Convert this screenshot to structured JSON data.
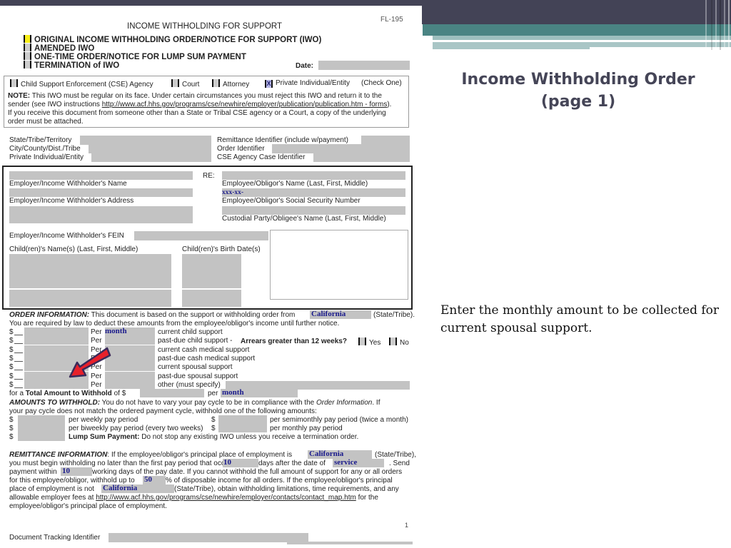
{
  "slide": {
    "title_line1": "Income Withholding Order",
    "title_line2": "(page 1)",
    "note": "Enter the monthly amount to be collected for current spousal support.",
    "colors": {
      "header_dark": "#434356",
      "header_teal": "#4a8483",
      "title": "#454557",
      "arrow": "#e8202a"
    }
  },
  "form": {
    "form_number": "FL-195",
    "heading": "INCOME WITHHOLDING FOR SUPPORT",
    "type_options": [
      {
        "label": "ORIGINAL INCOME WITHHOLDING ORDER/NOTICE FOR SUPPORT (IWO)",
        "state": "highlighted"
      },
      {
        "label": "AMENDED IWO",
        "state": "unchecked"
      },
      {
        "label": "ONE-TIME ORDER/NOTICE FOR LUMP SUM PAYMENT",
        "state": "unchecked"
      },
      {
        "label": "TERMINATION of IWO",
        "state": "unchecked"
      }
    ],
    "date_label": "Date:",
    "sender_options": [
      {
        "label": "Child Support Enforcement (CSE) Agency",
        "mark": ""
      },
      {
        "label": "Court",
        "mark": ""
      },
      {
        "label": "Attorney",
        "mark": ""
      },
      {
        "label": "Private Individual/Entity",
        "mark": "X"
      }
    ],
    "check_one": "(Check One)",
    "note_label": "NOTE:",
    "note_text1": " This IWO must be regular on its face. Under certain circumstances you must reject this IWO and return it to the",
    "note_text2a": "sender (see IWO instructions ",
    "note_link": "http://www.acf.hhs.gov/programs/cse/newhire/employer/publication/publication.htm - forms",
    "note_text2b": ").",
    "note_text3": "If you receive this document from someone other than a State or Tribal CSE agency or a Court, a copy of the underlying",
    "note_text4": "order must be attached.",
    "id_left": [
      "State/Tribe/Territory",
      "City/County/Dist./Tribe",
      "Private Individual/Entity"
    ],
    "id_right": [
      "Remittance Identifier (include w/payment)",
      "Order Identifier",
      "CSE Agency Case Identifier"
    ],
    "re_label": "RE:",
    "employer_name_label": "Employer/Income Withholder's Name",
    "employer_address_label": "Employer/Income Withholder's Address",
    "employee_name_label": "Employee/Obligor's Name (Last, First, Middle)",
    "ssn_value": "xxx-xx-",
    "ssn_label": "Employee/Obligor's Social Security Number",
    "custodial_label": "Custodial Party/Obligee's Name (Last, First, Middle)",
    "fein_label": "Employer/Income Withholder's FEIN",
    "children_names_label": "Child(ren)'s Name(s) (Last, First, Middle)",
    "children_dob_label": "Child(ren)'s Birth Date(s)",
    "order_info": {
      "heading": "ORDER INFORMATION:",
      "text1": " This document is based on the support or withholding order from ",
      "state_value": "California",
      "state_suffix": "(State/Tribe).",
      "text2": "You are required by law to deduct these amounts from the employee/obligor's income until further notice.",
      "dollar": "$",
      "per": "Per",
      "rows": [
        {
          "per_value": "month",
          "description": "current child support"
        },
        {
          "per_value": "",
          "description": "past-due child support - "
        },
        {
          "per_value": "",
          "description": "current cash medical support"
        },
        {
          "per_value": "",
          "description": "past-due cash medical support"
        },
        {
          "per_value": "",
          "description": "current spousal support"
        },
        {
          "per_value": "",
          "description": "past-due spousal support"
        },
        {
          "per_value": "",
          "description": "other (must specify)"
        }
      ],
      "arrears_question": "Arrears greater than 12 weeks?",
      "yes_label": "Yes",
      "no_label": "No",
      "total_prefix": "for a ",
      "total_bold": "Total Amount to Withhold",
      "total_of": " of $",
      "total_per": "per",
      "total_per_value": "month"
    },
    "amounts": {
      "heading": "AMOUNTS TO WITHHOLD:",
      "text1a": " You do not have to vary your pay cycle to be in compliance with the ",
      "text1_italic": "Order Information",
      "text1b": ". If",
      "text2": "your pay cycle does not match the ordered payment cycle, withhold one of the following amounts:",
      "dollar": "$",
      "weekly": "per weekly pay period",
      "semimonthly": "per semimonthly pay period (twice a month)",
      "biweekly": "per biweekly pay period (every two weeks)",
      "monthly": "per monthly pay period",
      "lump_bold": "Lump Sum Payment:",
      "lump_text": " Do not stop any existing IWO unless you receive a termination order."
    },
    "remittance": {
      "heading": "REMITTANCE INFORMATION",
      "l1a": ": If the employee/obligor's principal place of employment is ",
      "state_value": "California",
      "l1b": "(State/Tribe),",
      "l2a": "you must begin withholding no later than the first pay period that occur",
      "days_value": "10",
      "l2b": " days after the date of ",
      "service_value": "service",
      "l2c": ". Send",
      "l3a": "payment within ",
      "working_days_value": "10",
      "l3b": " working days of the pay date. If you cannot withhold the full amount of support for any or all orders",
      "l4a": "for this employee/obligor, withhold up to ",
      "percent_value": "50",
      "l4b": " % of disposable income for all orders. If the employee/obligor's principal",
      "l5a": "place of employment is not ",
      "state_value2": "California",
      "l5b": " (State/Tribe), obtain withholding limitations, time requirements, and any",
      "l6a": "allowable employer fees at ",
      "link": "http://www.acf.hhs.gov/programs/cse/newhire/employer/contacts/contact_map.htm",
      "l6b": " for the",
      "l7": "employee/obligor's principal place of employment."
    },
    "page_number": "1",
    "tracking_label": "Document Tracking Identifier"
  }
}
